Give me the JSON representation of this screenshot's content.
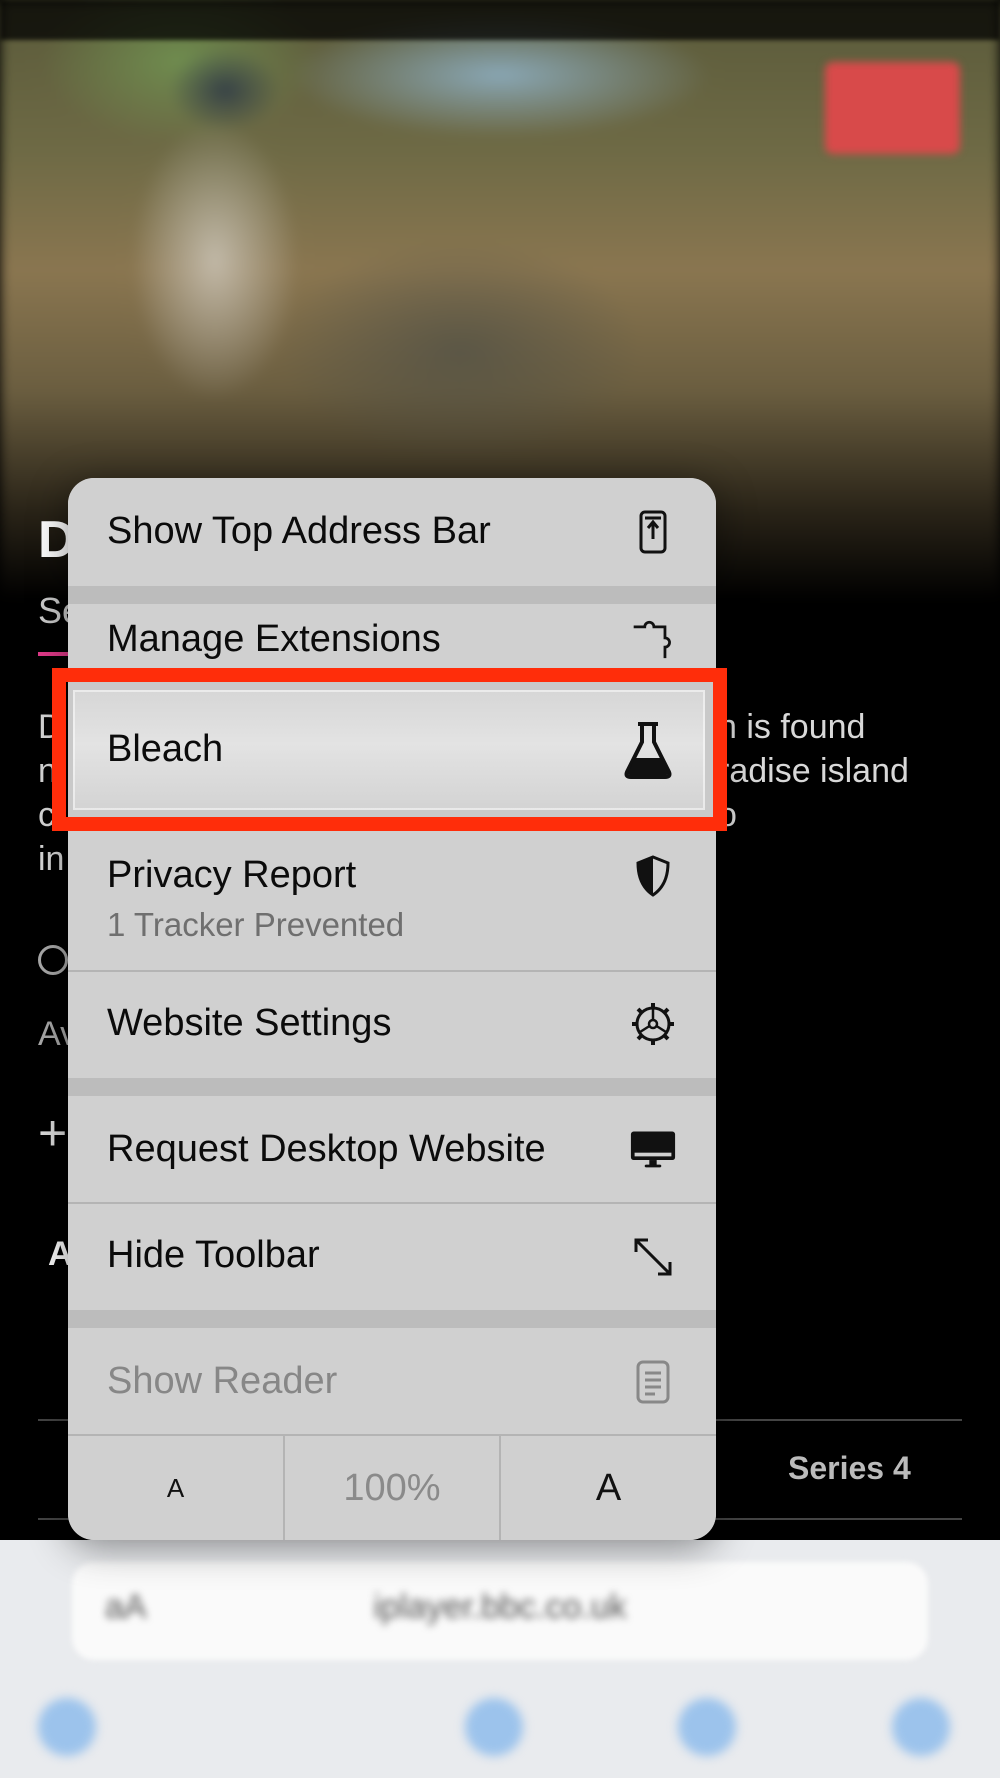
{
  "menu": {
    "show_top_address_bar": "Show Top Address Bar",
    "manage_extensions": "Manage Extensions",
    "bleach": "Bleach",
    "privacy_report": "Privacy Report",
    "privacy_report_sub": "1 Tracker Prevented",
    "website_settings": "Website Settings",
    "request_desktop_website": "Request Desktop Website",
    "hide_toolbar": "Hide Toolbar",
    "show_reader": "Show Reader",
    "font_smaller": "A",
    "zoom_level": "100%",
    "font_larger": "A"
  },
  "background": {
    "title": "D",
    "subtitle": "Se",
    "desc": [
      "D",
      "n",
      "c",
      "in"
    ],
    "desc_right": [
      "n is found",
      "radise island",
      "o"
    ],
    "av": "Av",
    "plus": "+",
    "a_label": "A",
    "series_tab": "Series 4"
  },
  "toolbar": {
    "aa": "aA",
    "address": "iplayer.bbc.co.uk"
  },
  "colors": {
    "highlight": "#ff2d0a",
    "menu_bg": "#d0d0d0",
    "accent_pink": "#e23a8a"
  }
}
